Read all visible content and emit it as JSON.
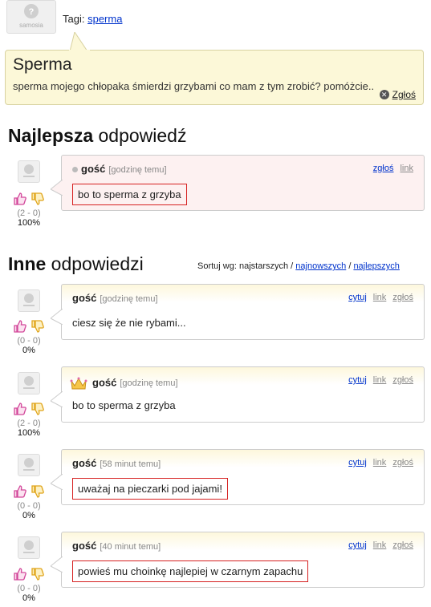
{
  "tags": {
    "label": "Tagi:",
    "tag": "sperma"
  },
  "avatar_text": "samosia",
  "question": {
    "title": "Sperma",
    "body": "sperma mojego chłopaka śmierdzi grzybami co mam z tym zrobić? pomóżcie..",
    "report_label": "Zgłoś"
  },
  "best": {
    "heading_bold": "Najlepsza",
    "heading_rest": " odpowiedź",
    "answer": {
      "author": "gość",
      "time": "[godzinę temu]",
      "text": "bo to sperma z grzyba",
      "links": [
        "zgłoś",
        "link"
      ],
      "votes": "(2 - 0)",
      "percent": "100%"
    }
  },
  "others": {
    "heading_bold": "Inne",
    "heading_rest": " odpowiedzi",
    "sort": {
      "label": "Sortuj wg: najstarszych / ",
      "newest": "najnowszych",
      "sep": " / ",
      "best": "najlepszych"
    },
    "answers": [
      {
        "author": "gość",
        "time": "[godzinę temu]",
        "text": "ciesz się że nie rybami...",
        "links": [
          "cytuj",
          "link",
          "zgłoś"
        ],
        "votes": "(0 - 0)",
        "percent": "0%"
      },
      {
        "author": "gość",
        "time": "[godzinę temu]",
        "text": "bo to sperma z grzyba",
        "links": [
          "cytuj",
          "link",
          "zgłoś"
        ],
        "votes": "(2 - 0)",
        "percent": "100%"
      },
      {
        "author": "gość",
        "time": "[58 minut temu]",
        "text": "uważaj na pieczarki pod jajami!",
        "links": [
          "cytuj",
          "link",
          "zgłoś"
        ],
        "votes": "(0 - 0)",
        "percent": "0%"
      },
      {
        "author": "gość",
        "time": "[40 minut temu]",
        "text": "powieś mu choinkę najlepiej w czarnym zapachu",
        "links": [
          "cytuj",
          "link",
          "zgłoś"
        ],
        "votes": "(0 - 0)",
        "percent": "0%"
      }
    ]
  }
}
